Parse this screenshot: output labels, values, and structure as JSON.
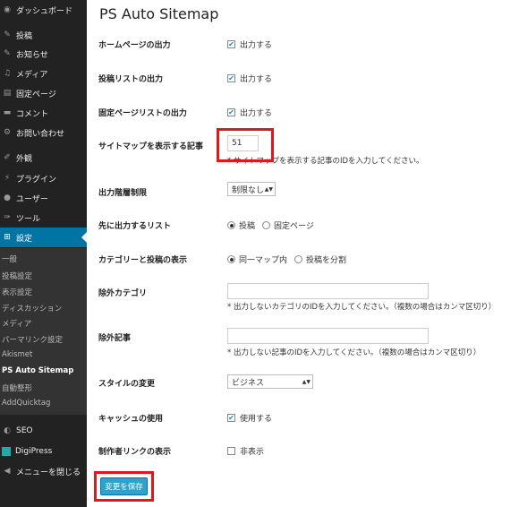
{
  "sidebar": {
    "items": [
      {
        "label": "ダッシュボード",
        "icon": "dashboard-icon",
        "glyph": "◉"
      },
      {
        "label": "投稿",
        "icon": "pin-icon",
        "glyph": "✎"
      },
      {
        "label": "お知らせ",
        "icon": "pin-icon",
        "glyph": "✎"
      },
      {
        "label": "メディア",
        "icon": "media-icon",
        "glyph": "♫"
      },
      {
        "label": "固定ページ",
        "icon": "page-icon",
        "glyph": "▤"
      },
      {
        "label": "コメント",
        "icon": "comment-icon",
        "glyph": "▬"
      },
      {
        "label": "お問い合わせ",
        "icon": "gear-icon",
        "glyph": "⚙"
      },
      {
        "label": "外観",
        "icon": "brush-icon",
        "glyph": "✐"
      },
      {
        "label": "プラグイン",
        "icon": "plugin-icon",
        "glyph": "⚡"
      },
      {
        "label": "ユーザー",
        "icon": "user-icon",
        "glyph": "●"
      },
      {
        "label": "ツール",
        "icon": "wrench-icon",
        "glyph": "✑"
      },
      {
        "label": "設定",
        "icon": "settings-icon",
        "glyph": "⊞"
      }
    ],
    "submenu": [
      "一般",
      "投稿設定",
      "表示設定",
      "ディスカッション",
      "メディア",
      "パーマリンク設定",
      "Akismet",
      "PS Auto Sitemap",
      "自動整形",
      "AddQuicktag"
    ],
    "seo_label": "SEO",
    "digipress_label": "DigiPress",
    "collapse_label": "メニューを閉じる"
  },
  "main": {
    "title": "PS Auto Sitemap",
    "rows": {
      "home_output": {
        "label": "ホームページの出力",
        "option": "出力する",
        "checked": true
      },
      "post_list_output": {
        "label": "投稿リストの出力",
        "option": "出力する",
        "checked": true
      },
      "page_list_output": {
        "label": "固定ページリストの出力",
        "option": "出力する",
        "checked": true
      },
      "sitemap_page": {
        "label": "サイトマップを表示する記事",
        "value": "51",
        "help": "* サイトマップを表示する記事のIDを入力してください。"
      },
      "depth_limit": {
        "label": "出力階層制限",
        "selected": "制限なし"
      },
      "first_list": {
        "label": "先に出力するリスト",
        "options": [
          "投稿",
          "固定ページ"
        ],
        "selected": "投稿"
      },
      "category_post_display": {
        "label": "カテゴリーと投稿の表示",
        "options": [
          "同一マップ内",
          "投稿を分割"
        ],
        "selected": "同一マップ内"
      },
      "exclude_category": {
        "label": "除外カテゴリ",
        "value": "",
        "help": "* 出力しないカテゴリのIDを入力してください。（複数の場合はカンマ区切り）"
      },
      "exclude_post": {
        "label": "除外記事",
        "value": "",
        "help": "* 出力しない記事のIDを入力してください。（複数の場合はカンマ区切り）"
      },
      "style": {
        "label": "スタイルの変更",
        "selected": "ビジネス"
      },
      "cache": {
        "label": "キャッシュの使用",
        "option": "使用する",
        "checked": true
      },
      "author_link": {
        "label": "制作者リンクの表示",
        "option": "非表示",
        "checked": false
      }
    },
    "save_label": "変更を保存"
  },
  "colors": {
    "sidebar_bg": "#222222",
    "active_bg": "#0074a2",
    "button_bg": "#2ea2cc",
    "highlight": "#e0181c"
  }
}
